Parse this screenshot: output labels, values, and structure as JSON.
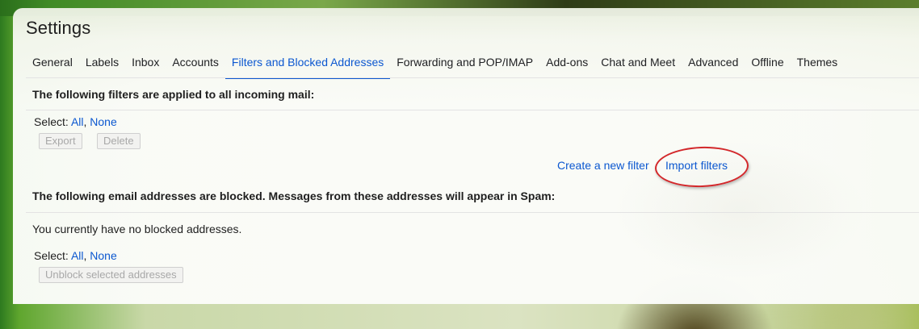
{
  "settings": {
    "title": "Settings",
    "tabs": [
      {
        "label": "General"
      },
      {
        "label": "Labels"
      },
      {
        "label": "Inbox"
      },
      {
        "label": "Accounts"
      },
      {
        "label": "Filters and Blocked Addresses",
        "active": true
      },
      {
        "label": "Forwarding and POP/IMAP"
      },
      {
        "label": "Add-ons"
      },
      {
        "label": "Chat and Meet"
      },
      {
        "label": "Advanced"
      },
      {
        "label": "Offline"
      },
      {
        "label": "Themes"
      }
    ]
  },
  "filters": {
    "heading": "The following filters are applied to all incoming mail:",
    "select_label": "Select:",
    "select_all": "All",
    "select_none": "None",
    "export_label": "Export",
    "delete_label": "Delete",
    "create_link": "Create a new filter",
    "import_link": "Import filters"
  },
  "blocked": {
    "heading": "The following email addresses are blocked. Messages from these addresses will appear in Spam:",
    "empty_text": "You currently have no blocked addresses.",
    "select_label": "Select:",
    "select_all": "All",
    "select_none": "None",
    "unblock_label": "Unblock selected addresses"
  },
  "annotation": {
    "highlight_color": "#d3272a",
    "highlight_target": "import-filters-link"
  },
  "colors": {
    "accent": "#0b57d0",
    "disabled_text": "#a8a8a8"
  }
}
